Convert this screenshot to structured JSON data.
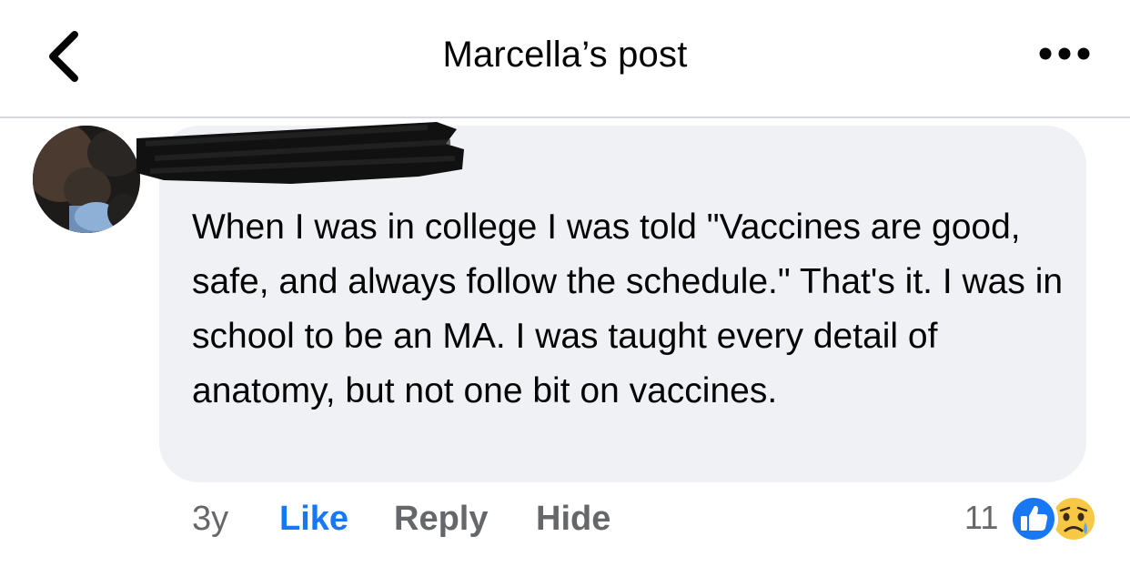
{
  "header": {
    "title": "Marcella’s post",
    "back_icon": "chevron-left-icon",
    "more_icon": "more-horizontal-icon"
  },
  "comment": {
    "text": "When I was in college I was told \"Vaccines are good, safe, and always follow the schedule.\" That's it. I was in school to be an MA. I was taught every detail of anatomy, but not one bit on vaccines.",
    "author_redacted": true,
    "actions": {
      "time": "3y",
      "like": "Like",
      "reply": "Reply",
      "hide": "Hide"
    },
    "reactions": {
      "count": "11",
      "icons": [
        "like-reaction-icon",
        "sad-reaction-icon"
      ]
    }
  },
  "colors": {
    "accent_blue": "#1877f2",
    "secondary_text": "#65676b",
    "bubble_bg": "#f0f1f4",
    "divider": "#d6d8dc",
    "sad_yellow": "#f7c843"
  }
}
